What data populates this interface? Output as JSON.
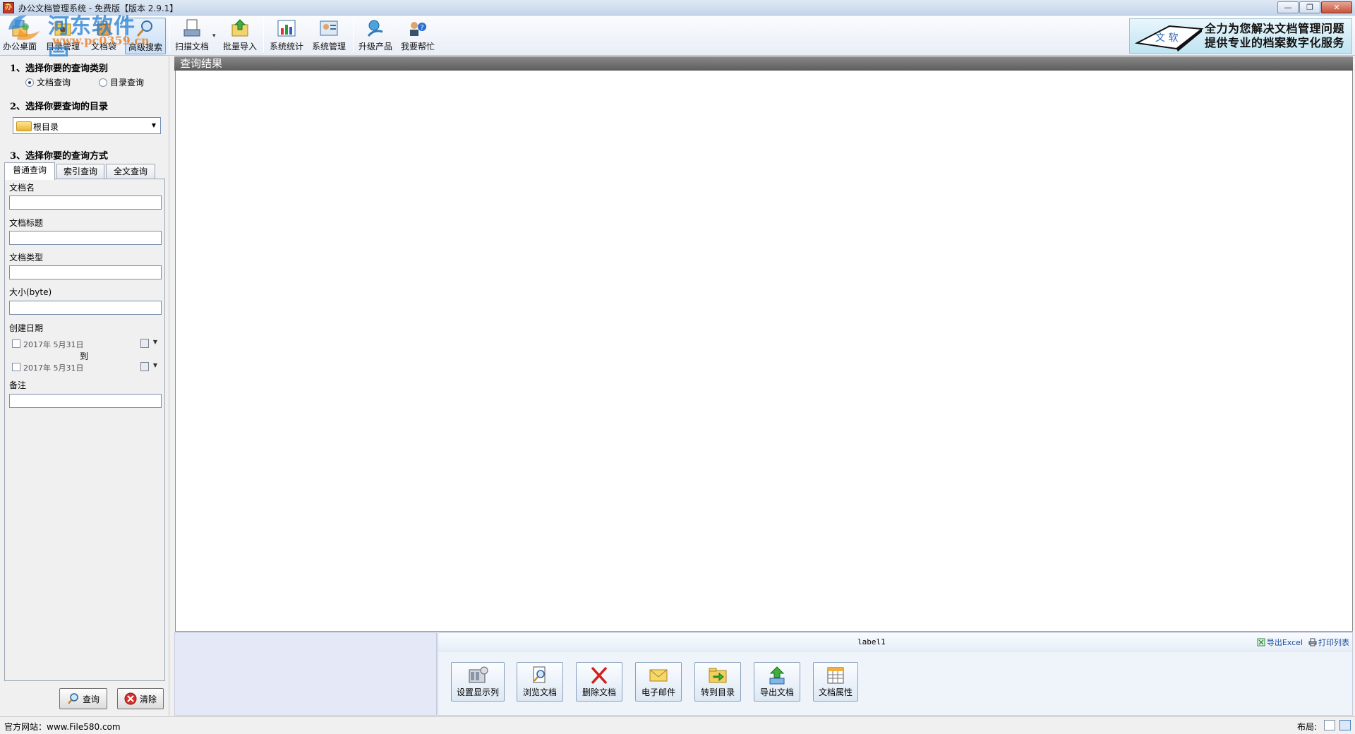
{
  "window": {
    "title": "办公文档管理系统 - 免费版【版本 2.9.1】",
    "app_icon": "办",
    "buttons": [
      "minimize",
      "restore",
      "close"
    ]
  },
  "watermark": {
    "main": "河东软件园",
    "url": "www.pc0359.cn"
  },
  "toolbar": {
    "items": [
      {
        "label": "办公桌面",
        "icon": "desk-icon"
      },
      {
        "label": "目录管理",
        "icon": "directory-icon"
      },
      {
        "label": "文档袋",
        "icon": "document-bag-icon"
      },
      {
        "label": "高级搜索",
        "icon": "advanced-search-icon",
        "active": true
      },
      {
        "label": "扫描文档",
        "icon": "scan-icon",
        "dropdown": true
      },
      {
        "label": "批量导入",
        "icon": "batch-import-icon"
      },
      {
        "label": "系统统计",
        "icon": "statistics-icon"
      },
      {
        "label": "系统管理",
        "icon": "system-admin-icon"
      },
      {
        "label": "升级产品",
        "icon": "upgrade-icon"
      },
      {
        "label": "我要帮忙",
        "icon": "help-icon"
      }
    ],
    "banner": {
      "book_text": "文 软",
      "line1": "全力为您解决文档管理问题",
      "line2": "提供专业的档案数字化服务"
    }
  },
  "left": {
    "step1": "1、选择你要的查询类别",
    "radio_doc": "文档查询",
    "radio_dir": "目录查询",
    "step2": "2、选择你要查询的目录",
    "dir_value": "根目录",
    "step3": "3、选择你要的查询方式",
    "tabs": [
      "普通查询",
      "索引查询",
      "全文查询"
    ],
    "fields": {
      "doc_name": "文档名",
      "doc_title": "文档标题",
      "doc_type": "文档类型",
      "size": "大小(byte)",
      "created": "创建日期",
      "date_from": "2017年  5月31日",
      "to": "到",
      "date_to": "2017年  5月31日",
      "remark": "备注"
    },
    "query_btn": "查询",
    "clear_btn": "清除"
  },
  "results": {
    "header": "查询结果",
    "label1": "label1",
    "export_excel": "导出Excel",
    "print_list": "打印列表",
    "actions": [
      {
        "label": "设置显示列",
        "icon": "columns-icon"
      },
      {
        "label": "浏览文档",
        "icon": "browse-icon"
      },
      {
        "label": "删除文档",
        "icon": "delete-icon"
      },
      {
        "label": "电子邮件",
        "icon": "email-icon"
      },
      {
        "label": "转到目录",
        "icon": "goto-dir-icon"
      },
      {
        "label": "导出文档",
        "icon": "export-icon"
      },
      {
        "label": "文档属性",
        "icon": "properties-icon"
      }
    ]
  },
  "status": {
    "site": "官方网站：www.File580.com",
    "layout_label": "布局:"
  },
  "colors": {
    "accent": "#6ea0d8",
    "header_gray": "#6e6e6e",
    "bottom_panel": "#e5e8f6"
  }
}
